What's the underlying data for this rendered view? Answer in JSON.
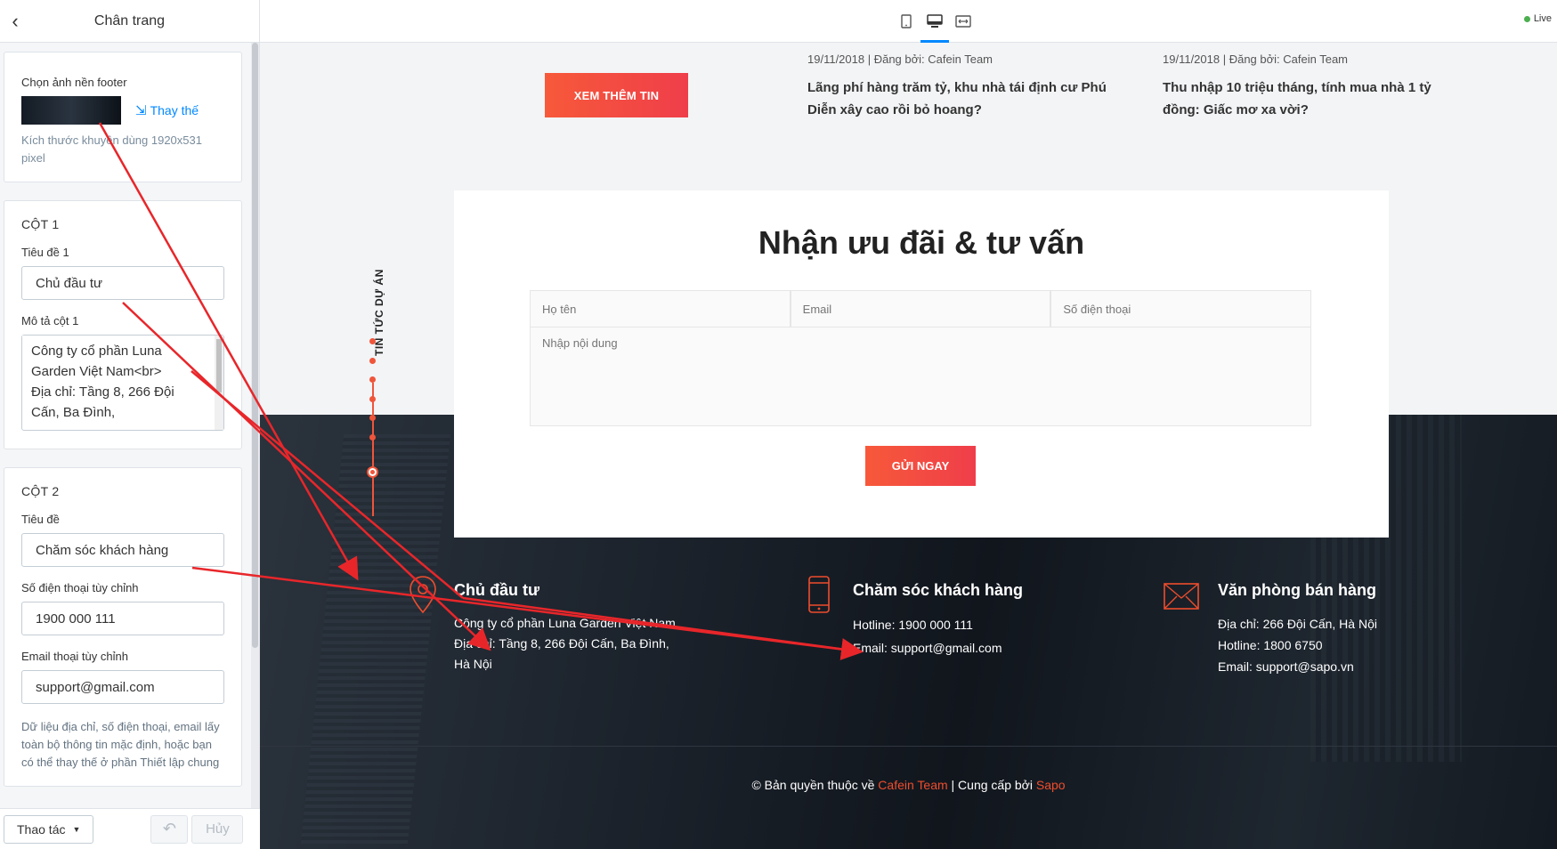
{
  "sidebar": {
    "title": "Chân trang",
    "bg_card": {
      "label": "Chọn ảnh nền footer",
      "replace_label": "Thay thế",
      "hint": "Kích thước khuyên dùng 1920x531 pixel"
    },
    "col1": {
      "heading": "CỘT 1",
      "title_label": "Tiêu đề 1",
      "title_value": "Chủ đầu tư",
      "desc_label": "Mô tả cột 1",
      "desc_value": "Công ty cổ phần Luna Garden Việt Nam<br>\nĐịa chỉ: Tầng 8, 266 Đội Cấn, Ba Đình,"
    },
    "col2": {
      "heading": "CỘT 2",
      "title_label": "Tiêu đề",
      "title_value": "Chăm sóc khách hàng",
      "phone_label": "Số điện thoại tùy chỉnh",
      "phone_value": "1900 000 111",
      "email_label": "Email thoại tùy chỉnh",
      "email_value": "support@gmail.com",
      "hint": "Dữ liệu địa chỉ, số điện thoại, email lấy toàn bộ thông tin mặc định, hoặc bạn có thể thay thế ở phần Thiết lập chung"
    },
    "footer": {
      "action_label": "Thao tác",
      "cancel_label": "Hủy"
    }
  },
  "topbar": {
    "devices": [
      "mobile-icon",
      "desktop-icon",
      "fullwidth-icon"
    ],
    "active_device": "desktop-icon",
    "live_label": "Live"
  },
  "preview": {
    "more_news_button": "XEM THÊM TIN",
    "news": [
      {
        "meta": "19/11/2018  |  Đăng bởi: Cafein Team",
        "title": "Lãng phí hàng trăm tỷ, khu nhà tái định cư Phú Diễn xây cao rồi bỏ hoang?"
      },
      {
        "meta": "19/11/2018  |  Đăng bởi: Cafein Team",
        "title": "Thu nhập 10 triệu tháng, tính mua nhà 1 tỷ đồng: Giấc mơ xa vời?"
      }
    ],
    "vertical_label": "TIN TỨC DỰ ÁN",
    "form": {
      "title": "Nhận ưu đãi & tư vấn",
      "name_placeholder": "Họ tên",
      "email_placeholder": "Email",
      "phone_placeholder": "Số điện thoại",
      "content_placeholder": "Nhập nội dung",
      "submit_label": "GỬI NGAY"
    },
    "footer": {
      "columns": [
        {
          "icon": "map-pin-icon",
          "title": "Chủ đầu tư",
          "lines": [
            "Công ty cổ phần Luna Garden Việt Nam",
            "Địa chỉ: Tầng 8, 266 Đội Cấn, Ba Đình,",
            "Hà Nội"
          ]
        },
        {
          "icon": "phone-icon",
          "title": "Chăm sóc khách hàng",
          "lines": [
            "Hotline: 1900 000 111",
            "Email: support@gmail.com"
          ]
        },
        {
          "icon": "envelope-icon",
          "title": "Văn phòng bán hàng",
          "lines": [
            "Địa chỉ: 266 Đội Cấn, Hà Nội",
            "Hotline: 1800 6750",
            "Email: support@sapo.vn"
          ]
        }
      ],
      "copyright_prefix": "© Bản quyền thuộc về",
      "copyright_owner": "Cafein Team",
      "copyright_mid": "| Cung cấp bởi",
      "copyright_provider": "Sapo"
    }
  },
  "colors": {
    "accent": "#0088ff",
    "brand_red": "#ee4d2d",
    "annotation_arrow": "#e8262a"
  }
}
